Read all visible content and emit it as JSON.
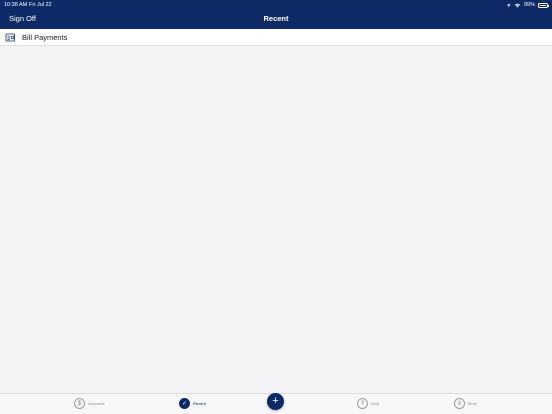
{
  "status_bar": {
    "time": "10:38 AM",
    "date": "Fri Jul 22",
    "battery": "99%",
    "icons": [
      "location-icon",
      "wifi-icon",
      "battery-icon"
    ]
  },
  "header": {
    "sign_off": "Sign Off",
    "title": "Recent",
    "background": "#0e2a66"
  },
  "list": {
    "items": [
      {
        "label": "Bill Payments",
        "icon": "bill-payments-icon"
      }
    ]
  },
  "tabbar": {
    "tabs": [
      {
        "label": "Accounts",
        "icon": "dollar-icon",
        "glyph": "$",
        "active": false
      },
      {
        "label": "Recent",
        "icon": "check-icon",
        "glyph": "✓",
        "active": true
      },
      {
        "label": "Help",
        "icon": "question-icon",
        "glyph": "?",
        "active": false
      },
      {
        "label": "More",
        "icon": "menu-icon",
        "glyph": "≡",
        "active": false
      }
    ],
    "add_button_glyph": "+"
  }
}
